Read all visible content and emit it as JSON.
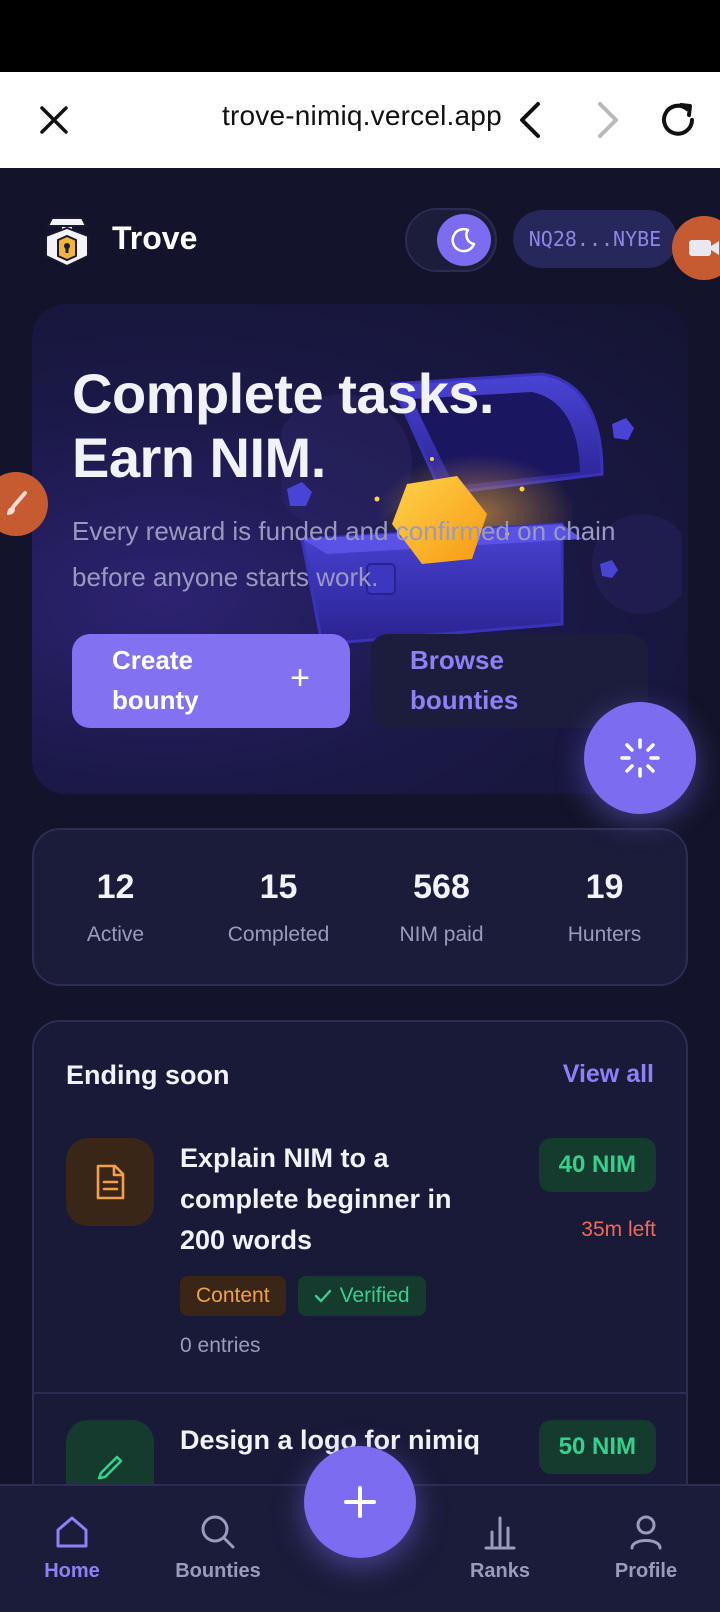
{
  "browser": {
    "url": "trove-nimiq.vercel.app"
  },
  "header": {
    "brand": "Trove",
    "wallet": "NQ28...NYBE"
  },
  "hero": {
    "title_line1": "Complete tasks.",
    "title_line2": "Earn NIM.",
    "subtitle": "Every reward is funded and confirmed on chain before anyone starts work.",
    "create_label": "Create bounty",
    "browse_label": "Browse bounties"
  },
  "stats": [
    {
      "value": "12",
      "label": "Active"
    },
    {
      "value": "15",
      "label": "Completed"
    },
    {
      "value": "568",
      "label": "NIM paid"
    },
    {
      "value": "19",
      "label": "Hunters"
    }
  ],
  "ending": {
    "title": "Ending soon",
    "view_all": "View all",
    "items": [
      {
        "title": "Explain NIM to a complete beginner in 200 words",
        "reward": "40 NIM",
        "time_left": "35m left",
        "category": "Content",
        "verified": "Verified",
        "entries": "0 entries",
        "icon": "document-icon"
      },
      {
        "title": "Design a logo for nimiq",
        "reward": "50 NIM",
        "icon": "pen-icon"
      }
    ]
  },
  "nav": {
    "home": "Home",
    "bounties": "Bounties",
    "ranks": "Ranks",
    "profile": "Profile"
  },
  "colors": {
    "accent": "#7b6cf0",
    "success": "#36d08d",
    "warning": "#f0a04a",
    "danger": "#f06a5a",
    "background": "#13142b"
  }
}
